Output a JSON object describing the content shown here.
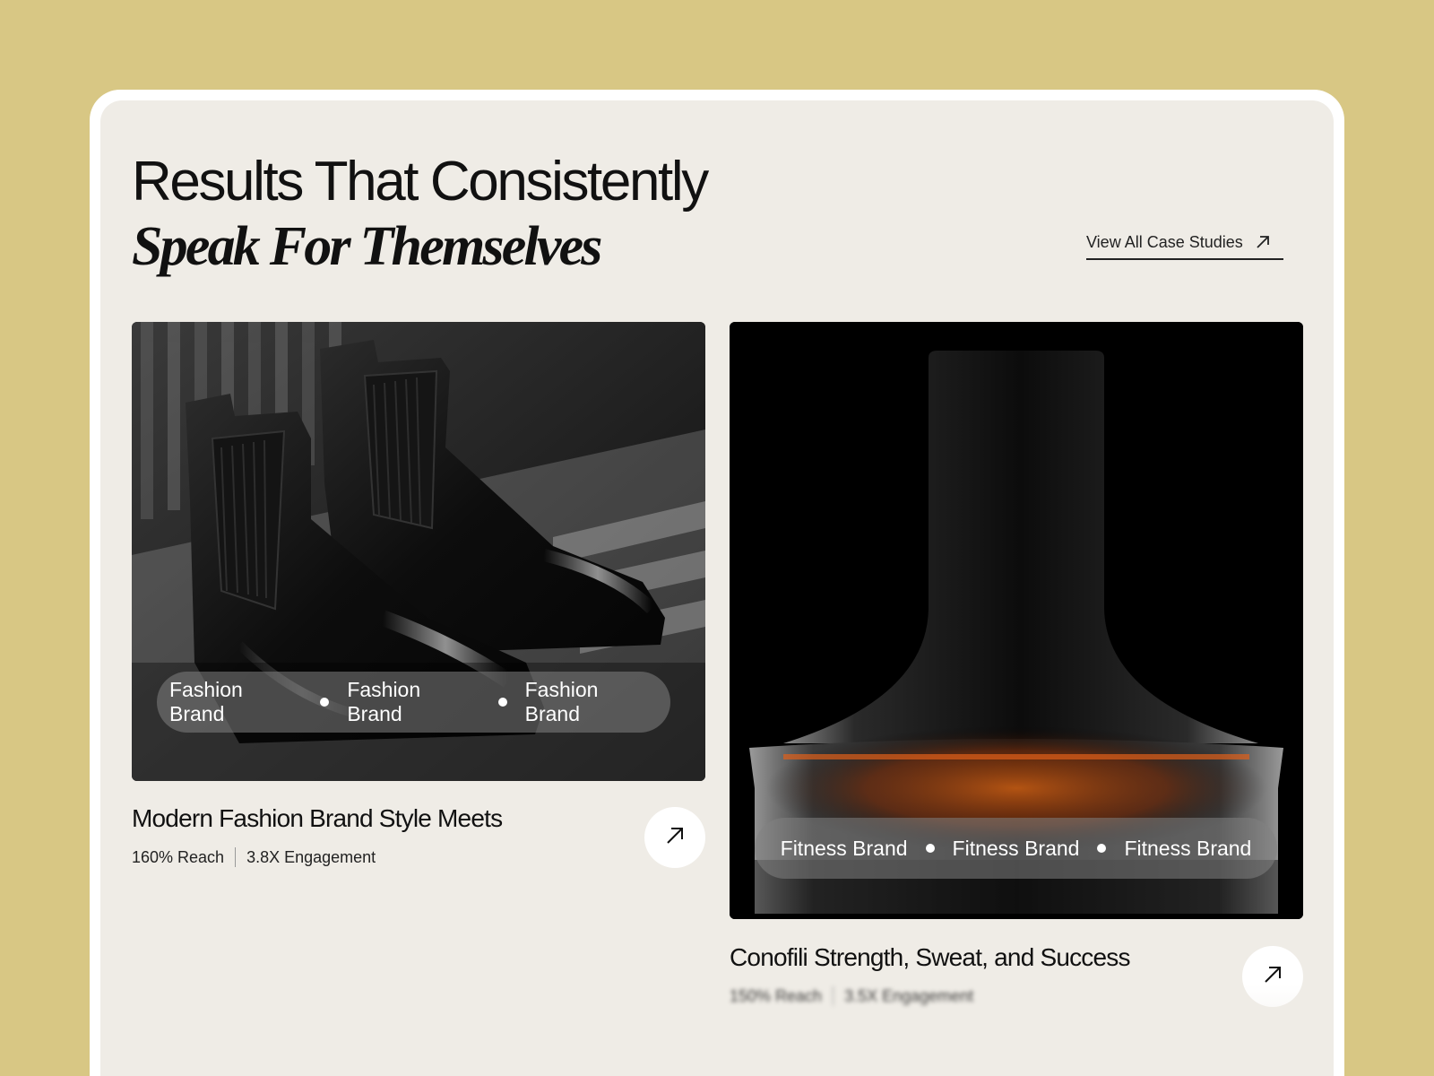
{
  "header": {
    "title_line1": "Results That Consistently",
    "title_line2": "Speak For Themselves",
    "view_all_label": "View All Case Studies"
  },
  "cards": [
    {
      "tags": [
        "Fashion Brand",
        "Fashion Brand",
        "Fashion Brand"
      ],
      "title": "Modern Fashion Brand Style Meets",
      "stat1": "160% Reach",
      "stat2": "3.8X Engagement",
      "image": "black-chelsea-boots-photo",
      "action_icon": "arrow-up-right-icon"
    },
    {
      "tags": [
        "Fitness Brand",
        "Fitness Brand",
        "Fitness Brand"
      ],
      "title": "Conofili Strength, Sweat, and Success",
      "stat1": "150% Reach",
      "stat2": "3.5X Engagement",
      "image": "dark-product-bottle-photo",
      "action_icon": "arrow-up-right-icon"
    }
  ],
  "colors": {
    "background": "#d8c784",
    "panel": "#efece6",
    "text": "#111111"
  }
}
